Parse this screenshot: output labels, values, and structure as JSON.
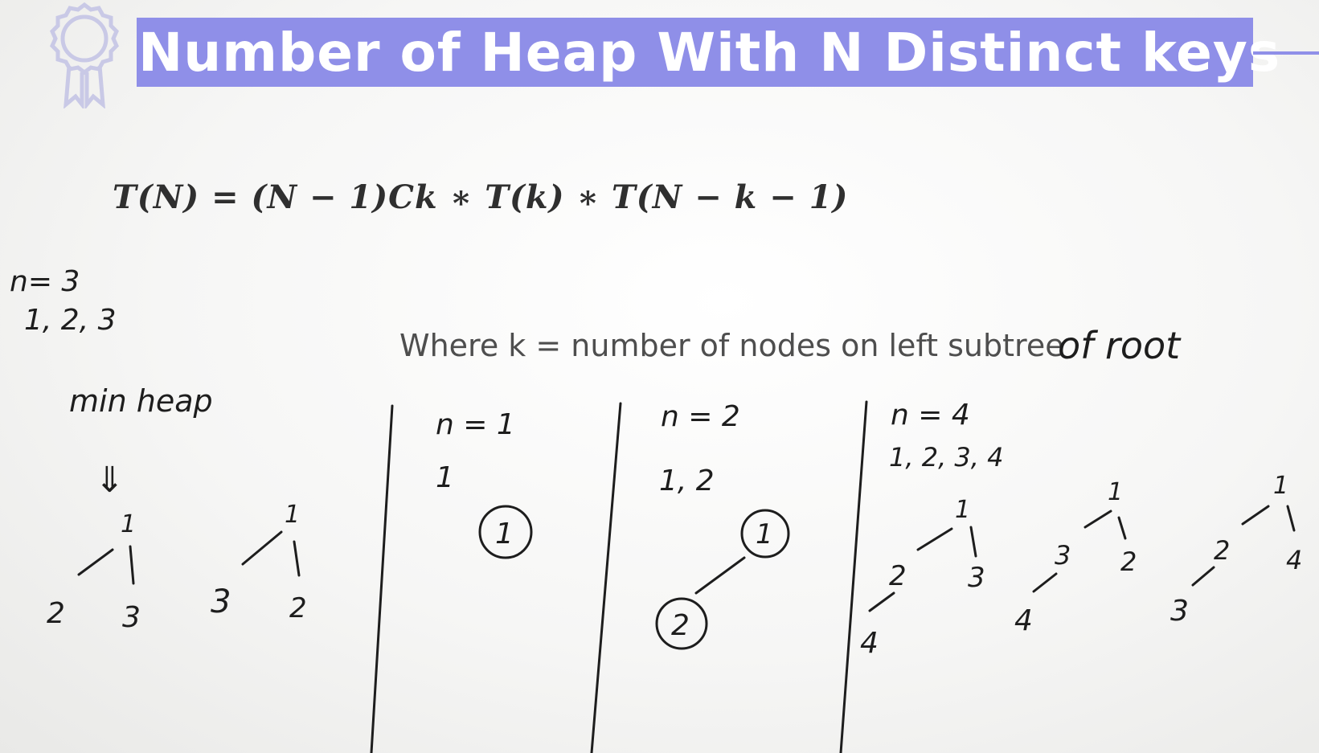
{
  "title": "Number of Heap With N Distinct keys",
  "formula": "T(N) = (N − 1)Ck ∗ T(k) ∗ T(N − k − 1)",
  "where_text": "Where k = number of nodes on left subtree",
  "annotations": {
    "where_suffix": "of root",
    "n3_label": "n= 3",
    "n3_keys": "1, 2, 3",
    "min_heap": "min heap",
    "arrow": "⇓",
    "n1_label": "n = 1",
    "n1_keys": "1",
    "n2_label": "n = 2",
    "n2_keys": "1, 2",
    "n4_label": "n = 4",
    "n4_keys": "1, 2, 3, 4"
  },
  "trees": {
    "n3_tree_a": {
      "root": "1",
      "left": "2",
      "right": "3"
    },
    "n3_tree_b": {
      "root": "1",
      "left": "3",
      "right": "2"
    },
    "n1_tree": {
      "root": "1"
    },
    "n2_tree": {
      "root": "1",
      "left": "2"
    },
    "n4_tree_a": {
      "root": "1",
      "left": "2",
      "right": "3",
      "left_left": "4"
    },
    "n4_tree_b": {
      "root": "1",
      "left": "3",
      "right": "2",
      "left_left": "4"
    },
    "n4_tree_c": {
      "root": "1",
      "left": "2",
      "right": "4",
      "left_left": "3"
    }
  },
  "colors": {
    "title_bg": "#8f8fe8",
    "title_text": "#ffffff",
    "ink": "#1d1d1d"
  },
  "icons": {
    "badge": "ribbon-award-icon"
  }
}
